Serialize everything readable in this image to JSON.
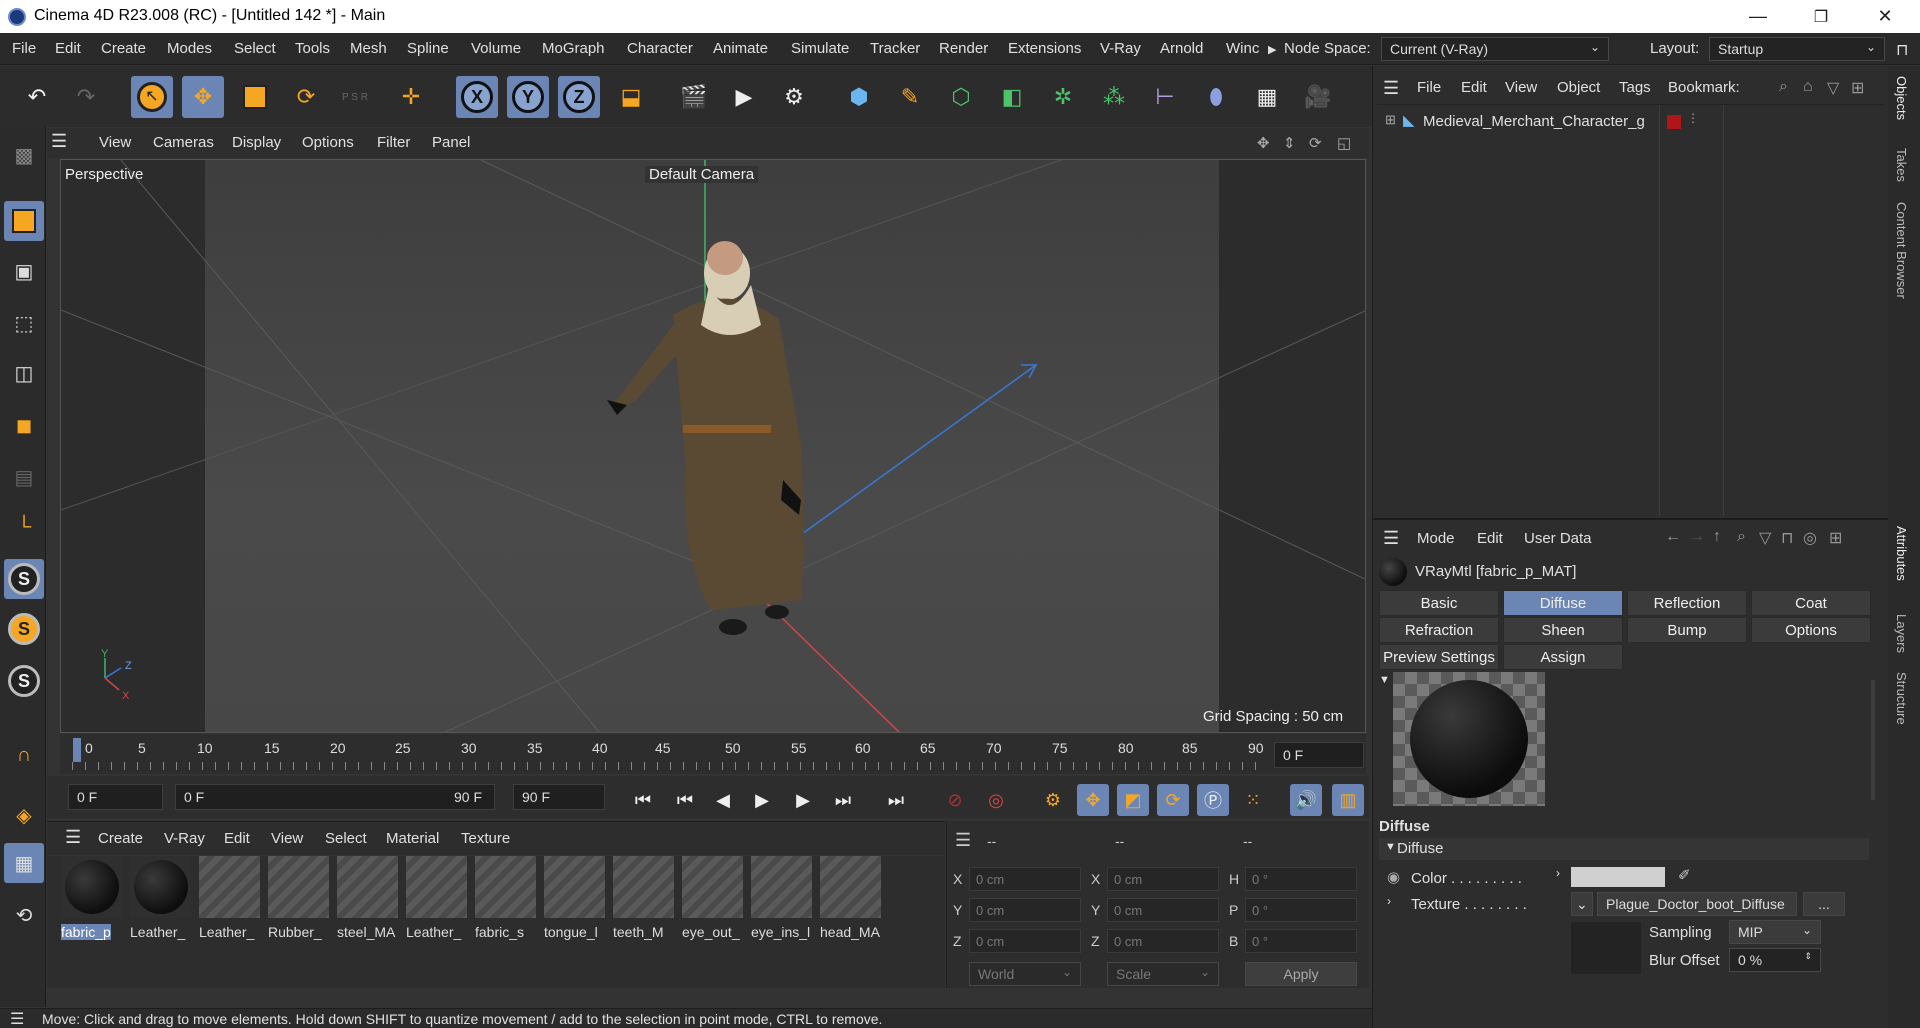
{
  "window": {
    "title": "Cinema 4D R23.008 (RC) - [Untitled 142 *] - Main",
    "min": "—",
    "max": "❐",
    "close": "✕"
  },
  "menubar": {
    "items": [
      "File",
      "Edit",
      "Create",
      "Modes",
      "Select",
      "Tools",
      "Mesh",
      "Spline",
      "Volume",
      "MoGraph",
      "Character",
      "Animate",
      "Simulate",
      "Tracker",
      "Render",
      "Extensions",
      "V-Ray",
      "Arnold",
      "Winc"
    ],
    "node_space_label": "Node Space:",
    "node_space_value": "Current (V-Ray)",
    "layout_label": "Layout:",
    "layout_value": "Startup"
  },
  "toolbar": {
    "psr": "P S R"
  },
  "viewport": {
    "menu": [
      "View",
      "Cameras",
      "Display",
      "Options",
      "Filter",
      "Panel"
    ],
    "view_name": "Perspective",
    "camera": "Default Camera",
    "grid_spacing": "Grid Spacing : 50 cm",
    "axes": {
      "y": "Y",
      "z": "Z",
      "x": "X"
    }
  },
  "timeline": {
    "ticks": [
      "0",
      "5",
      "10",
      "15",
      "20",
      "25",
      "30",
      "35",
      "40",
      "45",
      "50",
      "55",
      "60",
      "65",
      "70",
      "75",
      "80",
      "85",
      "90"
    ],
    "current_frame": "0 F"
  },
  "transport": {
    "start": "0 F",
    "range_start": "0 F",
    "range_end": "90 F",
    "end": "90 F"
  },
  "material_manager": {
    "menu": [
      "Create",
      "V-Ray",
      "Edit",
      "View",
      "Select",
      "Material",
      "Texture"
    ],
    "materials": [
      "fabric_p",
      "Leather_",
      "Leather_",
      "Rubber_",
      "steel_MA",
      "Leather_",
      "fabric_s",
      "tongue_l",
      "teeth_M",
      "eye_out_",
      "eye_ins_l",
      "head_MA"
    ]
  },
  "coordinates": {
    "headers": [
      "--",
      "--",
      "--"
    ],
    "rows": [
      {
        "a": "X",
        "av": "0 cm",
        "b": "X",
        "bv": "0 cm",
        "c": "H",
        "cv": "0 °"
      },
      {
        "a": "Y",
        "av": "0 cm",
        "b": "Y",
        "bv": "0 cm",
        "c": "P",
        "cv": "0 °"
      },
      {
        "a": "Z",
        "av": "0 cm",
        "b": "Z",
        "bv": "0 cm",
        "c": "B",
        "cv": "0 °"
      }
    ],
    "space": "World",
    "mode": "Scale",
    "apply": "Apply"
  },
  "status": "Move: Click and drag to move elements. Hold down SHIFT to quantize movement / add to the selection in point mode, CTRL to remove.",
  "object_manager": {
    "menu": [
      "File",
      "Edit",
      "View",
      "Object",
      "Tags",
      "Bookmark:"
    ],
    "object": "Medieval_Merchant_Character_g"
  },
  "attributes": {
    "menu": [
      "Mode",
      "Edit",
      "User Data"
    ],
    "material": "VRayMtl [fabric_p_MAT]",
    "tabs": [
      "Basic",
      "Diffuse",
      "Reflection",
      "Coat",
      "Refraction",
      "Sheen",
      "Bump",
      "Options",
      "Preview Settings",
      "Assign"
    ],
    "section": "Diffuse",
    "group": "Diffuse",
    "color_label": "Color . . . . . . . . .",
    "texture_label": "Texture . . . . . . . .",
    "texture_value": "Plague_Doctor_boot_Diffuse",
    "more": "...",
    "sampling_label": "Sampling",
    "sampling_value": "MIP",
    "blur_label": "Blur Offset",
    "blur_value": "0 %"
  },
  "side_tabs": [
    "Objects",
    "Takes",
    "Content Browser",
    "Attributes",
    "Layers",
    "Structure"
  ]
}
